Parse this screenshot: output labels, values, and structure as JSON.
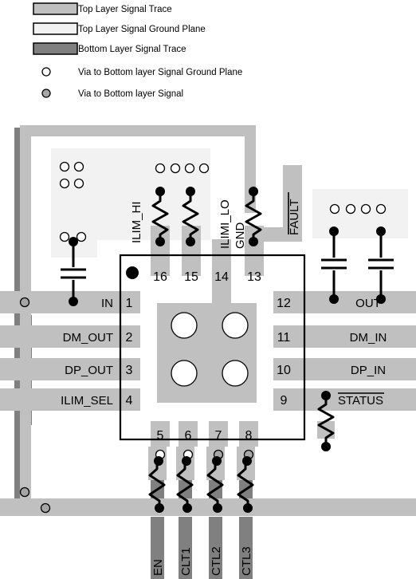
{
  "legend": {
    "items": [
      {
        "id": "top-layer-signal-trace",
        "label": "Top Layer Signal Trace",
        "swatch": "rect",
        "color": "#c0c0c0"
      },
      {
        "id": "top-layer-signal-ground-plane",
        "label": "Top Layer Signal Ground Plane",
        "swatch": "rect",
        "color": "#f2f2f2"
      },
      {
        "id": "bottom-layer-signal-trace",
        "label": "Bottom Layer Signal Trace",
        "swatch": "rect",
        "color": "#808080"
      },
      {
        "id": "via-to-bottom-layer-signal-ground-plane",
        "label": "Via to Bottom layer Signal Ground Plane",
        "swatch": "circle-open",
        "color": "#ffffff"
      },
      {
        "id": "via-to-bottom-layer-signal",
        "label": "Via to Bottom layer Signal",
        "swatch": "circle-filled",
        "color": "#a6a6a6"
      }
    ]
  },
  "colors": {
    "top_trace": "#c0c0c0",
    "ground_plane": "#f2f2f2",
    "bottom_trace": "#808080",
    "via_signal_fill": "#a6a6a6",
    "via_gnd_fill": "#ffffff",
    "outline": "#000000",
    "text": "#000000"
  },
  "package": {
    "name": "16-pin QFN footprint",
    "thermal_pad_via_count": 4,
    "pin1_marker": "pin1-dot"
  },
  "pins": {
    "left": [
      {
        "number": "1",
        "label": "IN"
      },
      {
        "number": "2",
        "label": "DM_OUT"
      },
      {
        "number": "3",
        "label": "DP_OUT"
      },
      {
        "number": "4",
        "label": "ILIM_SEL"
      }
    ],
    "right": [
      {
        "number": "12",
        "label": "OUT",
        "overline": false
      },
      {
        "number": "11",
        "label": "DM_IN",
        "overline": false
      },
      {
        "number": "10",
        "label": "DP_IN",
        "overline": false
      },
      {
        "number": "9",
        "label": "STATUS",
        "overline": true
      }
    ],
    "top": [
      {
        "number": "16",
        "label": "ILIM_HI",
        "overline": false
      },
      {
        "number": "15",
        "label": "ILIMI_LO",
        "overline": false
      },
      {
        "number": "14",
        "label": "GND",
        "overline": false
      },
      {
        "number": "13",
        "label": "FAULT",
        "overline": true
      }
    ],
    "bottom": [
      {
        "number": "5",
        "label": "EN"
      },
      {
        "number": "6",
        "label": "CLT1"
      },
      {
        "number": "7",
        "label": "CTL2"
      },
      {
        "number": "8",
        "label": "CTL3"
      }
    ]
  },
  "components": {
    "input_capacitor_count": 1,
    "output_capacitor_count": 2,
    "top_resistor_count": 3,
    "bottom_resistor_count": 4,
    "status_pullup_resistor_count": 1
  },
  "via_groups": {
    "top_left_upper": 4,
    "top_left_lower": 2,
    "top_center": 4,
    "right_plane": 4,
    "bottom_pin_vias": 4,
    "left_trace_vias": 1,
    "bottom_left_vias": 2
  }
}
